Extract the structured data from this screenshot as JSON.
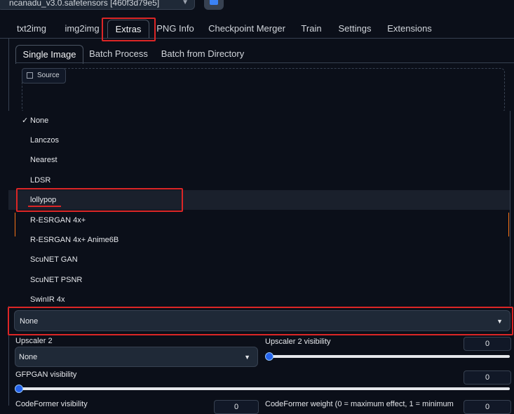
{
  "checkpoint": {
    "value": "ncanadu_v3.0.safetensors [460f3d79e5]"
  },
  "tabs": [
    "txt2img",
    "img2img",
    "Extras",
    "PNG Info",
    "Checkpoint Merger",
    "Train",
    "Settings",
    "Extensions"
  ],
  "active_tab": "Extras",
  "subtabs": [
    "Single Image",
    "Batch Process",
    "Batch from Directory"
  ],
  "active_subtab": "Single Image",
  "source": {
    "label": "Source"
  },
  "upscaler1": {
    "options": [
      "None",
      "Lanczos",
      "Nearest",
      "LDSR",
      "lollypop",
      "R-ESRGAN 4x+",
      "R-ESRGAN 4x+ Anime6B",
      "ScuNET GAN",
      "ScuNET PSNR",
      "SwinIR 4x"
    ],
    "checked": "None",
    "hovered": "lollypop",
    "value": "None"
  },
  "upscaler2": {
    "label": "Upscaler 2",
    "value": "None"
  },
  "upscaler2_visibility": {
    "label": "Upscaler 2 visibility",
    "value": "0",
    "level": 0
  },
  "gfpgan_visibility": {
    "label": "GFPGAN visibility",
    "value": "0",
    "level": 0
  },
  "codeformer_visibility": {
    "label": "CodeFormer visibility",
    "value": "0"
  },
  "codeformer_weight": {
    "label": "CodeFormer weight (0 = maximum effect, 1 = minimum",
    "value": "0"
  },
  "colors": {
    "highlight": "#dc2626",
    "accent": "#f97316",
    "slider": "#2563eb"
  }
}
